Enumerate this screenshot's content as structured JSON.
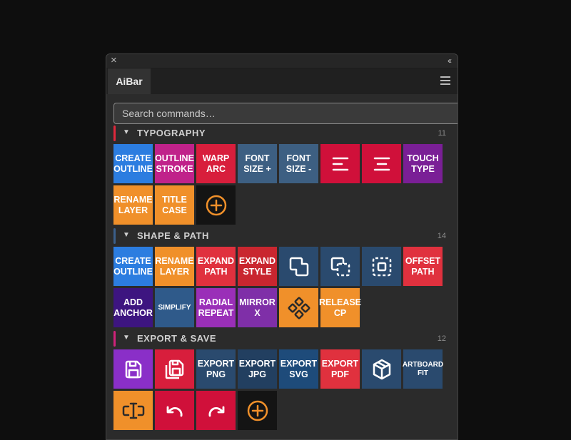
{
  "panel": {
    "tab_label": "AiBar",
    "search_placeholder": "Search commands…"
  },
  "sections": [
    {
      "title": "TYPOGRAPHY",
      "count": "11",
      "accent": "#e0283c",
      "tiles": [
        {
          "label": "CREATE\nOUTLINE",
          "color": "#2c7de0",
          "name": "create-outline-button"
        },
        {
          "label": "OUTLINE\nSTROKE",
          "color": "#c0228a",
          "name": "outline-stroke-button"
        },
        {
          "label": "WARP\nARC",
          "color": "#d81e3c",
          "name": "warp-arc-button"
        },
        {
          "label": "FONT\nSIZE +",
          "color": "#3d5f82",
          "name": "font-size-up-button"
        },
        {
          "label": "FONT\nSIZE -",
          "color": "#3d5f82",
          "name": "font-size-down-button"
        },
        {
          "icon": "align-left-icon",
          "color": "#d0103a",
          "name": "align-left-button"
        },
        {
          "icon": "align-center-icon",
          "color": "#d0103a",
          "name": "align-center-button"
        },
        {
          "label": "TOUCH\nTYPE",
          "color": "#7a1f96",
          "name": "touch-type-button"
        },
        {
          "label": "RENAME\nLAYER",
          "color": "#f0902a",
          "name": "rename-layer-button"
        },
        {
          "label": "TITLE\nCASE",
          "color": "#f0902a",
          "name": "title-case-button"
        },
        {
          "icon": "plus-circle-icon",
          "color": "#141414",
          "name": "add-command-button"
        }
      ]
    },
    {
      "title": "SHAPE & PATH",
      "count": "14",
      "accent": "#3b5f8a",
      "tiles": [
        {
          "label": "CREATE\nOUTLINE",
          "color": "#2c7de0",
          "name": "create-outline-button"
        },
        {
          "label": "RENAME\nLAYER",
          "color": "#f0902a",
          "name": "rename-layer-button"
        },
        {
          "label": "EXPAND\nPATH",
          "color": "#e0313e",
          "name": "expand-path-button"
        },
        {
          "label": "EXPAND\nSTYLE",
          "color": "#c9262f",
          "name": "expand-style-button"
        },
        {
          "icon": "unite-shapes-icon",
          "color": "#2a4a6e",
          "name": "unite-button"
        },
        {
          "icon": "minus-front-icon",
          "color": "#2a4a6e",
          "name": "minus-front-button"
        },
        {
          "icon": "intersect-icon",
          "color": "#2a4a6e",
          "name": "intersect-button"
        },
        {
          "label": "OFFSET\nPATH",
          "color": "#e0313e",
          "name": "offset-path-button"
        },
        {
          "label": "ADD\nANCHOR",
          "color": "#3d1580",
          "name": "add-anchor-button"
        },
        {
          "label": "SIMPLIFY",
          "color": "#2f5a8a",
          "name": "simplify-button",
          "small": true
        },
        {
          "label": "RADIAL\nREPEAT",
          "color": "#9a2fb8",
          "name": "radial-repeat-button"
        },
        {
          "label": "MIRROR\nX",
          "color": "#7f2fa8",
          "name": "mirror-x-button"
        },
        {
          "icon": "anchor-points-icon",
          "color": "#f0902a",
          "name": "anchor-points-button"
        },
        {
          "label": "RELEASE\nCP",
          "color": "#f0902a",
          "name": "release-cp-button"
        }
      ]
    },
    {
      "title": "EXPORT & SAVE",
      "count": "12",
      "accent": "#d0227a",
      "tiles": [
        {
          "icon": "save-icon",
          "color": "#8a2fc8",
          "name": "save-button"
        },
        {
          "icon": "save-as-icon",
          "color": "#d81e3c",
          "name": "save-as-button"
        },
        {
          "label": "EXPORT\nPNG",
          "color": "#2a4a6e",
          "name": "export-png-button"
        },
        {
          "label": "EXPORT\nJPG",
          "color": "#223f60",
          "name": "export-jpg-button"
        },
        {
          "label": "EXPORT\nSVG",
          "color": "#1e4b7a",
          "name": "export-svg-button"
        },
        {
          "label": "EXPORT\nPDF",
          "color": "#e0313e",
          "name": "export-pdf-button"
        },
        {
          "icon": "package-icon",
          "color": "#2a4a6e",
          "name": "package-button"
        },
        {
          "label": "ARTBOARD\nFIT",
          "color": "#2a4a6e",
          "name": "artboard-fit-button",
          "small": true
        },
        {
          "icon": "text-cursor-icon",
          "color": "#f0902a",
          "name": "text-cursor-button"
        },
        {
          "icon": "undo-icon",
          "color": "#d0103a",
          "name": "undo-button"
        },
        {
          "icon": "redo-icon",
          "color": "#d0103a",
          "name": "redo-button"
        },
        {
          "icon": "plus-circle-icon",
          "color": "#141414",
          "name": "add-command-button"
        }
      ]
    }
  ]
}
